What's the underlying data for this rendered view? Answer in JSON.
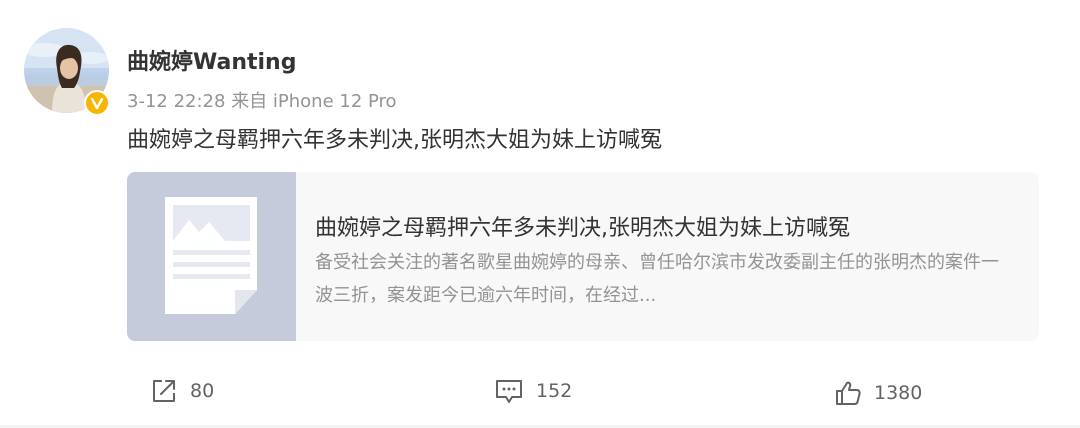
{
  "post": {
    "username": "曲婉婷Wanting",
    "timestamp": "3-12 22:28",
    "source": "来自 iPhone 12 Pro",
    "text": "曲婉婷之母羁押六年多未判决,张明杰大姐为妹上访喊冤",
    "verified_badge": "V"
  },
  "card": {
    "title": "曲婉婷之母羁押六年多未判决,张明杰大姐为妹上访喊冤",
    "description": "备受社会关注的著名歌星曲婉婷的母亲、曾任哈尔滨市发改委副主任的张明杰的案件一波三折，案发距今已逾六年时间，在经过...",
    "thumbnail_icon": "article-placeholder-icon"
  },
  "actions": {
    "repost_count": "80",
    "comment_count": "152",
    "like_count": "1380"
  },
  "colors": {
    "text_primary": "#333333",
    "text_secondary": "#939393",
    "card_background": "#f8f8f8",
    "thumb_background": "#c6cbdb",
    "verified_badge": "#f7b500"
  }
}
